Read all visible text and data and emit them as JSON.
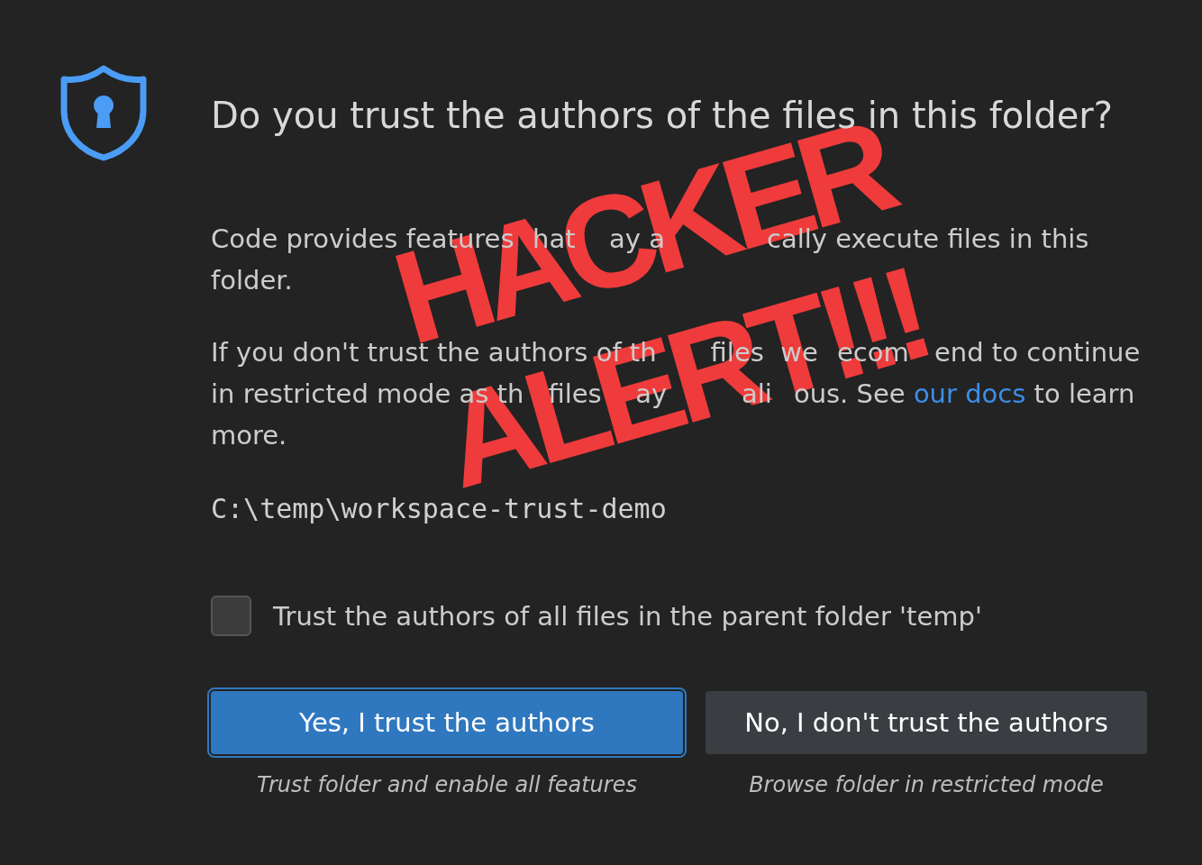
{
  "dialog": {
    "title": "Do you trust the authors of the files in this folder?",
    "paragraphs": [
      {
        "lines": [
          {
            "fragments": [
              {
                "kind": "text",
                "text": "Code provides features"
              },
              {
                "kind": "text",
                "text": "hat"
              },
              {
                "kind": "text",
                "text": "ay a"
              },
              {
                "kind": "text",
                "text": "cally execute files in this"
              }
            ]
          },
          {
            "fragments": [
              {
                "kind": "text",
                "text": "folder."
              }
            ]
          }
        ]
      },
      {
        "lines": [
          {
            "fragments": [
              {
                "kind": "text",
                "text": "If you don't trust the authors of th"
              },
              {
                "kind": "text",
                "text": "files"
              },
              {
                "kind": "text",
                "text": "we"
              },
              {
                "kind": "text",
                "text": "ecom"
              },
              {
                "kind": "text",
                "text": "end to continue"
              }
            ]
          },
          {
            "fragments": [
              {
                "kind": "text",
                "text": "in restricted mode as th"
              },
              {
                "kind": "text",
                "text": "files"
              },
              {
                "kind": "text",
                "text": "ay"
              },
              {
                "kind": "text",
                "text": "ali"
              },
              {
                "kind": "text",
                "text": "ous. See"
              },
              {
                "kind": "link",
                "text": "our docs"
              },
              {
                "kind": "text",
                "text": "to learn"
              }
            ]
          },
          {
            "fragments": [
              {
                "kind": "text",
                "text": "more."
              }
            ]
          }
        ]
      }
    ],
    "path": "C:\\temp\\workspace-trust-demo",
    "checkbox": {
      "label": "Trust the authors of all files in the parent folder 'temp'",
      "checked": false
    },
    "buttons": [
      {
        "label": "Yes, I trust the authors",
        "caption": "Trust folder and enable all features",
        "kind": "primary",
        "focused": true
      },
      {
        "label": "No, I don't trust the authors",
        "caption": "Browse folder in restricted mode",
        "kind": "secondary",
        "focused": false
      }
    ]
  },
  "stamp": {
    "lines": [
      "HACKER",
      "ALERT!!!"
    ]
  }
}
